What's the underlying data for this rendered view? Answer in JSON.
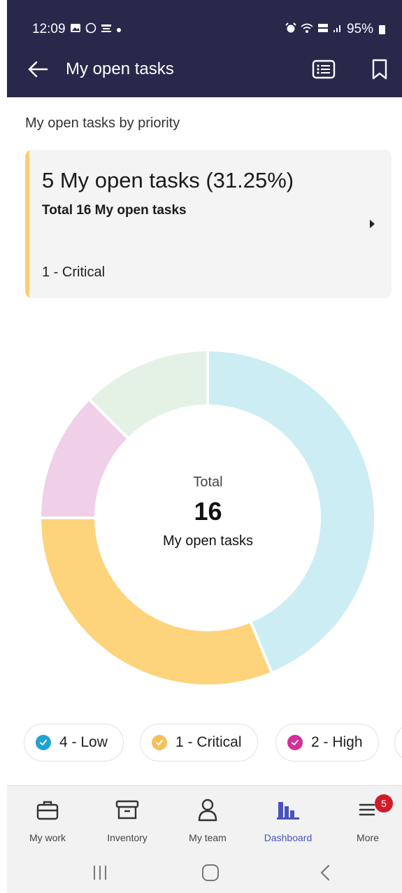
{
  "status_bar": {
    "time": "12:09",
    "battery": "95%",
    "left_icons": [
      "image-notification-icon",
      "whatsapp-icon",
      "app-notification-icon",
      "dot-icon"
    ],
    "right_icons": [
      "alarm-icon",
      "wifi-icon",
      "volte-icon",
      "signal-icon",
      "battery-icon"
    ]
  },
  "header": {
    "title": "My open tasks",
    "back_icon": "arrow-left-icon",
    "actions": [
      "list-view-icon",
      "bookmark-icon"
    ]
  },
  "section": {
    "title": "My open tasks by priority"
  },
  "summary_card": {
    "headline": "5 My open tasks (31.25%)",
    "subtitle": "Total 16 My open tasks",
    "category": "1 - Critical",
    "accent_color": "#fdcf72"
  },
  "donut_center": {
    "label": "Total",
    "count": "16",
    "sublabel": "My open tasks"
  },
  "chart_data": {
    "type": "pie",
    "title": "My open tasks by priority",
    "total": 16,
    "series": [
      {
        "name": "4 - Low",
        "value": 7,
        "color": "#ccedf3"
      },
      {
        "name": "1 - Critical",
        "value": 5,
        "color": "#fdd37b"
      },
      {
        "name": "2 - High",
        "value": 2,
        "color": "#f0cfe9"
      },
      {
        "name": "",
        "value": 2,
        "color": "#e3f2e5"
      }
    ]
  },
  "legend": [
    {
      "label": "4 - Low",
      "dot_color": "#1ea3d3"
    },
    {
      "label": "1 - Critical",
      "dot_color": "#f6c05a"
    },
    {
      "label": "2 - High",
      "dot_color": "#d42f9b"
    }
  ],
  "bottom_nav": {
    "items": [
      {
        "label": "My work",
        "icon": "briefcase-icon"
      },
      {
        "label": "Inventory",
        "icon": "archive-box-icon"
      },
      {
        "label": "My team",
        "icon": "person-icon"
      },
      {
        "label": "Dashboard",
        "icon": "bar-chart-icon",
        "active": true
      },
      {
        "label": "More",
        "icon": "menu-icon",
        "badge": "5"
      }
    ],
    "active_color": "#4a54b8"
  },
  "system_nav": [
    "recents-icon",
    "home-icon",
    "back-icon"
  ]
}
